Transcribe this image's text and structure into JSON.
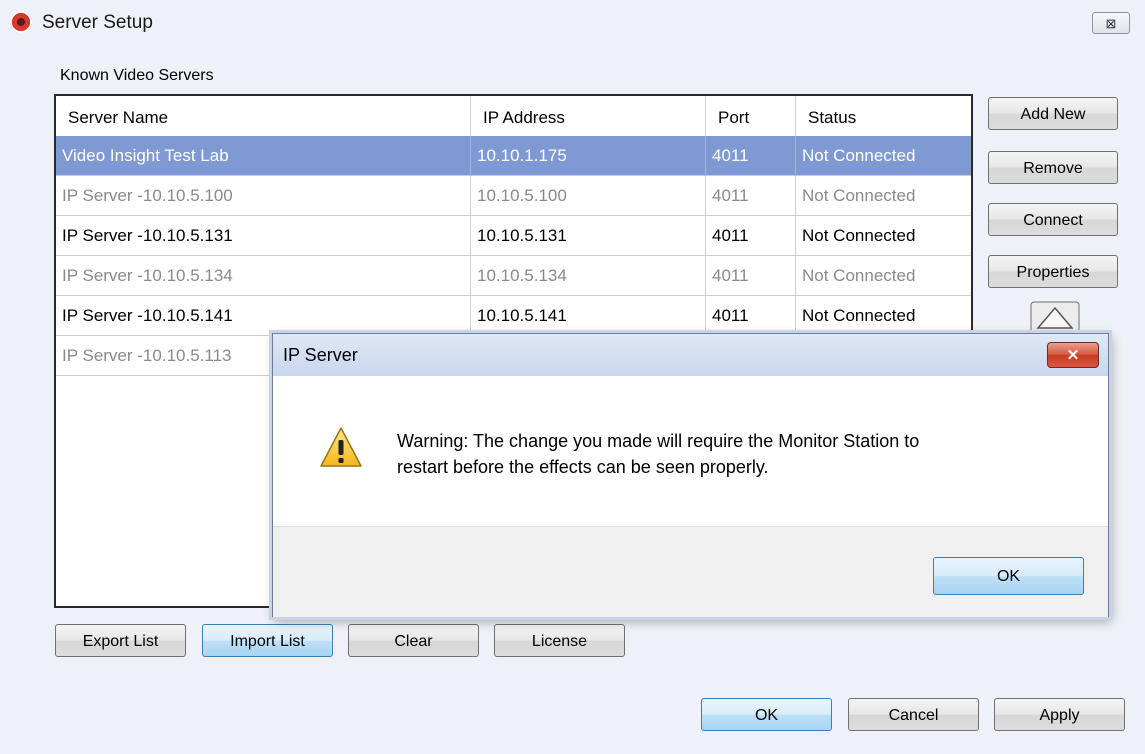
{
  "window": {
    "title": "Server Setup",
    "close_label": "⊠"
  },
  "server_list": {
    "label": "Known Video Servers",
    "columns": [
      "Server Name",
      "IP Address",
      "Port",
      "Status"
    ],
    "rows": [
      {
        "name": "Video Insight Test Lab",
        "ip": "10.10.1.175",
        "port": "4011",
        "status": "Not Connected"
      },
      {
        "name": "IP Server -10.10.5.100",
        "ip": "10.10.5.100",
        "port": "4011",
        "status": "Not Connected"
      },
      {
        "name": "IP Server -10.10.5.131",
        "ip": "10.10.5.131",
        "port": "4011",
        "status": "Not Connected"
      },
      {
        "name": "IP Server -10.10.5.134",
        "ip": "10.10.5.134",
        "port": "4011",
        "status": "Not Connected"
      },
      {
        "name": "IP Server -10.10.5.141",
        "ip": "10.10.5.141",
        "port": "4011",
        "status": "Not Connected"
      },
      {
        "name": "IP Server -10.10.5.113",
        "ip": "",
        "port": "",
        "status": ""
      }
    ]
  },
  "side_buttons": {
    "add_new": "Add New",
    "remove": "Remove",
    "connect": "Connect",
    "properties": "Properties"
  },
  "bottom_buttons": {
    "export": "Export List",
    "import": "Import List",
    "clear": "Clear",
    "license": "License"
  },
  "footer_buttons": {
    "ok": "OK",
    "cancel": "Cancel",
    "apply": "Apply"
  },
  "dialog": {
    "title": "IP Server",
    "close_label": "✕",
    "message_line1": "Warning:  The change you made will require the Monitor Station to",
    "message_line2": "restart before the effects can be seen properly.",
    "ok_label": "OK"
  },
  "colors": {
    "selection": "#7f9ad2",
    "window_bg": "#eef1f7",
    "close_red": "#c33c22",
    "warning_yellow": "#f2c12e"
  },
  "icons": {
    "app": "eye-icon",
    "warning": "warning-icon",
    "scroll_up": "arrow-up-icon"
  }
}
